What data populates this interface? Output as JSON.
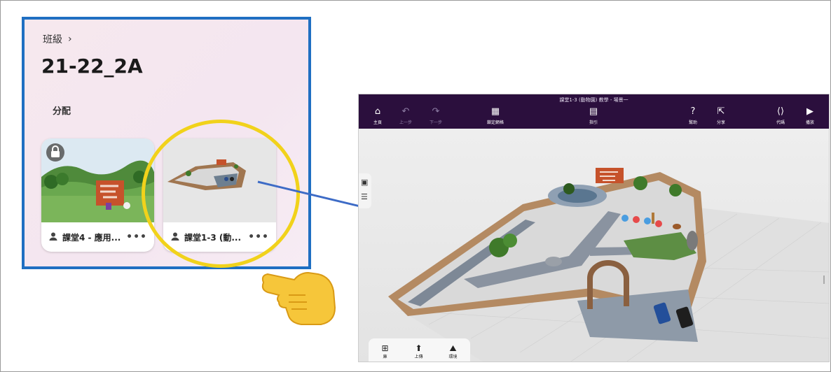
{
  "class_panel": {
    "breadcrumb": "班級",
    "breadcrumb_chevron": "›",
    "class_name": "21-22_2A",
    "section_label": "分配",
    "cards": [
      {
        "name": "課堂4 - 應用...",
        "locked": true,
        "more": "•••"
      },
      {
        "name": "課堂1-3 (動...",
        "locked": false,
        "more": "•••"
      }
    ]
  },
  "editor": {
    "title": "課堂1-3 (動物園) 教學 - 場景一",
    "toolbar": {
      "home": "主頁",
      "undo": "上一步",
      "redo": "下一步",
      "grid": "鎖定網格",
      "guide": "指引",
      "help": "幫助",
      "share": "分享",
      "code": "代碼",
      "play": "播放"
    },
    "bottom": {
      "library": "庫",
      "upload": "上傳",
      "environment": "環境"
    }
  },
  "colors": {
    "panel_border": "#1f6fc2",
    "highlight": "#f1d21b",
    "topbar": "#2b0f3d",
    "arrow": "#3d6bc6"
  }
}
